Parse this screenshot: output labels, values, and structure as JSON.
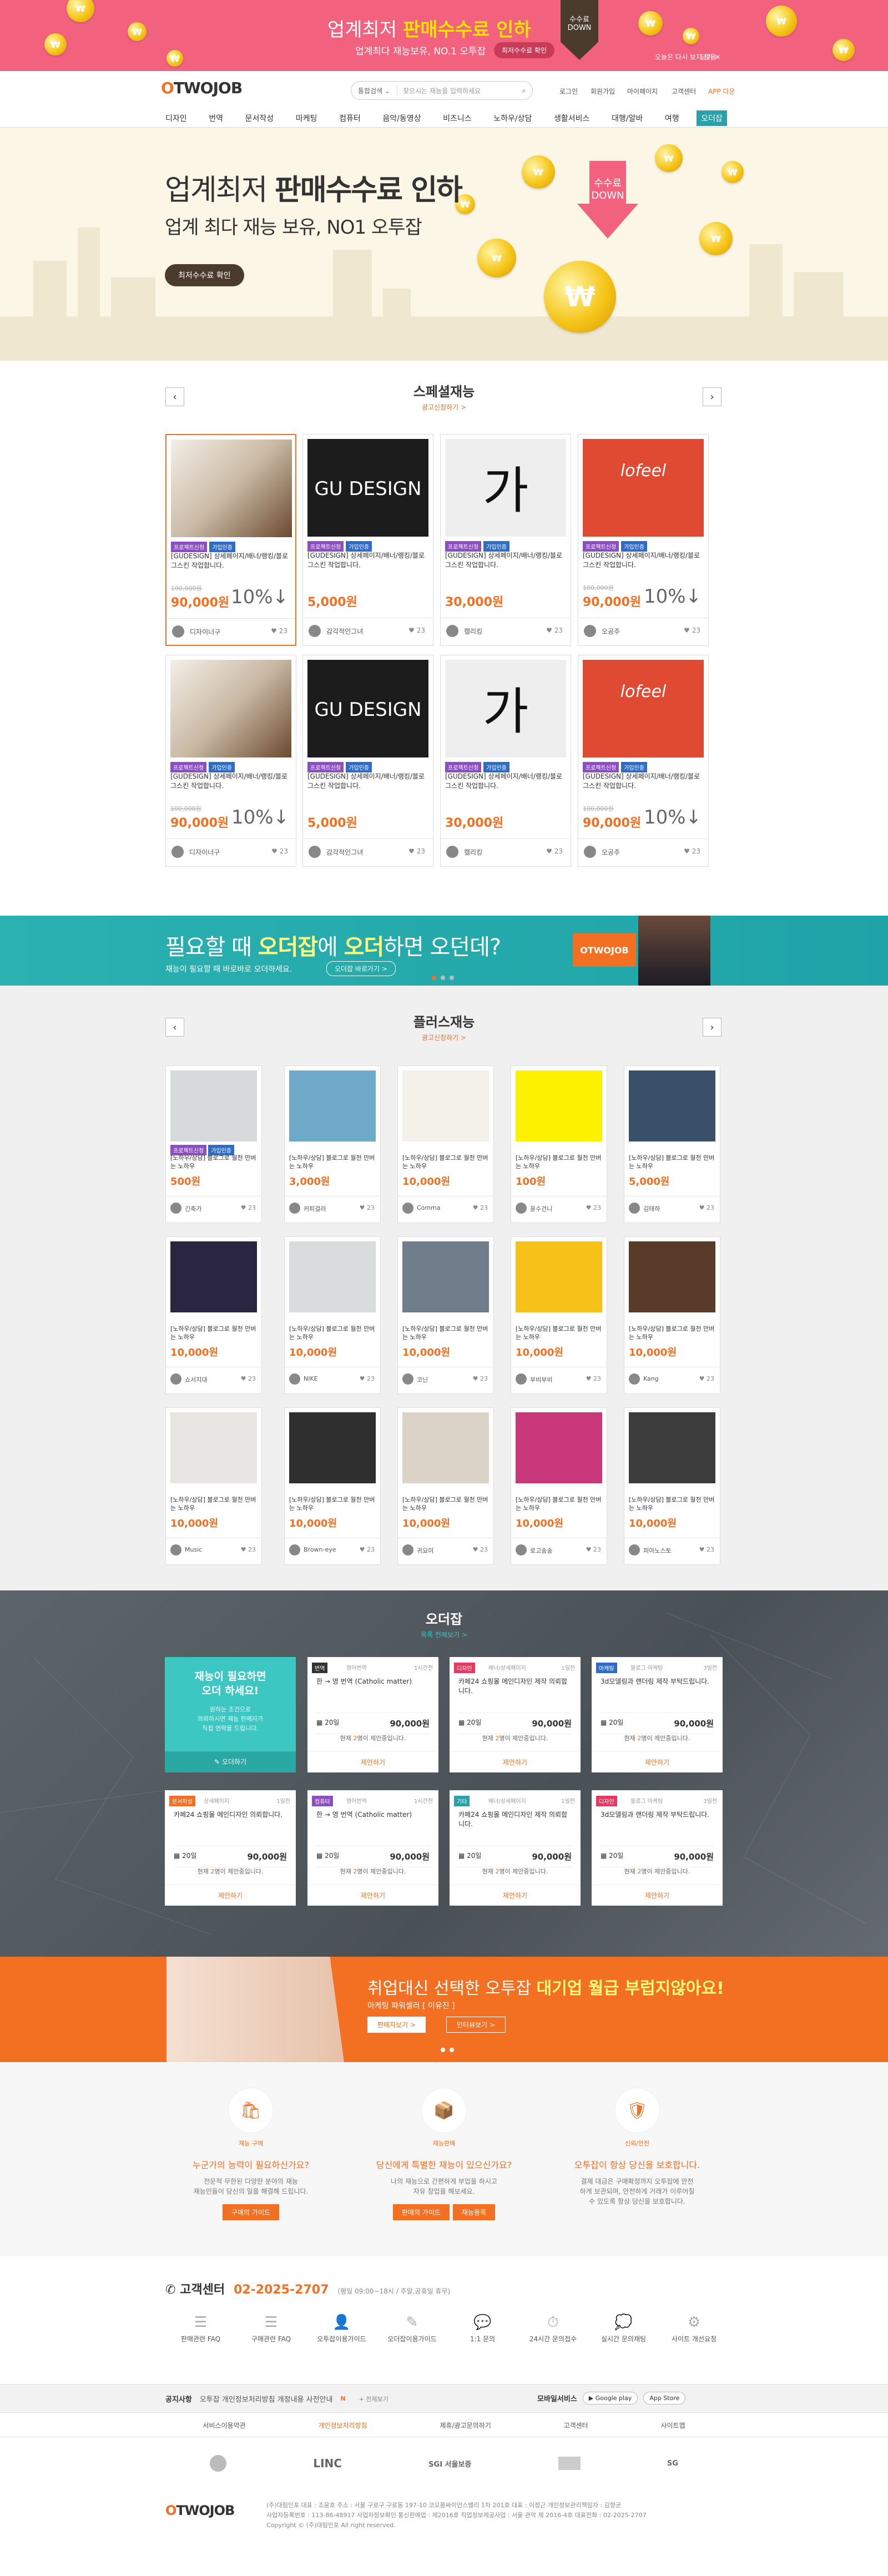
{
  "top_banner": {
    "title_pre": "업계최저 ",
    "title_bold": "판매수수료 인하",
    "subtitle": "업계최다 재능보유, NO.1 오투잡",
    "button": "최저수수료 확인",
    "arrow_line1": "수수료",
    "arrow_line2": "DOWN",
    "no_show": "오늘은 다시 보지 않음",
    "close": "닫기 ✕"
  },
  "header": {
    "logo_o": "O",
    "logo_rest": "TWOJOB",
    "search_select": "통합검색 ⌄",
    "search_placeholder": "찾으시는 재능을 입력하세요",
    "util": [
      "로그인",
      "회원가입",
      "마이페이지",
      "고객센터",
      "APP 다운"
    ],
    "nav": [
      "디자인",
      "번역",
      "문서작성",
      "마케팅",
      "컴퓨터",
      "음악/동영상",
      "비즈니스",
      "노하우/상담",
      "생활서비스",
      "대행/알바",
      "여행",
      "오더잡"
    ]
  },
  "hero": {
    "title_pre": "업계최저 ",
    "title_bold": "판매수수료 인하",
    "subtitle": "업계 최다 재능 보유, NO1 오투잡",
    "button": "최저수수료 확인",
    "down_line1": "수수료",
    "down_line2": "DOWN"
  },
  "special": {
    "title": "스페셜재능",
    "sub": "광고신청하기 >",
    "cards": [
      {
        "tags": [
          "프로젝트신청",
          "가입인증"
        ],
        "desc": "[GUDESIGN] 상세페이지/배너/랭킹/블로그스킨 작업합니다.",
        "old": "100,000원",
        "price": "90,000원",
        "badge": "10%↓",
        "seller": "디자이너구",
        "likes": "23",
        "img": "bottles"
      },
      {
        "tags": [
          "프로젝트신청",
          "가입인증"
        ],
        "desc": "[GUDESIGN] 상세페이지/배너/랭킹/블로그스킨 작업합니다.",
        "old": "",
        "price": "5,000원",
        "badge": "",
        "seller": "감각적인그녀",
        "likes": "23",
        "img": "gu"
      },
      {
        "tags": [
          "프로젝트신청",
          "가입인증"
        ],
        "desc": "[GUDESIGN] 상세페이지/배너/랭킹/블로그스킨 작업합니다.",
        "old": "",
        "price": "30,000원",
        "badge": "",
        "seller": "캘리킹",
        "likes": "23",
        "img": "calli"
      },
      {
        "tags": [
          "프로젝트신청",
          "가입인증"
        ],
        "desc": "[GUDESIGN] 상세페이지/배너/랭킹/블로그스킨 작업합니다.",
        "old": "100,000원",
        "price": "90,000원",
        "badge": "10%↓",
        "seller": "오공주",
        "likes": "23",
        "img": "lofeel"
      },
      {
        "tags": [
          "프로젝트신청",
          "가입인증"
        ],
        "desc": "[GUDESIGN] 상세페이지/배너/랭킹/블로그스킨 작업합니다.",
        "old": "100,000원",
        "price": "90,000원",
        "badge": "10%↓",
        "seller": "디자이너구",
        "likes": "23",
        "img": "bottles"
      },
      {
        "tags": [
          "프로젝트신청",
          "가입인증"
        ],
        "desc": "[GUDESIGN] 상세페이지/배너/랭킹/블로그스킨 작업합니다.",
        "old": "",
        "price": "5,000원",
        "badge": "",
        "seller": "감각적인그녀",
        "likes": "23",
        "img": "gu"
      },
      {
        "tags": [
          "프로젝트신청",
          "가입인증"
        ],
        "desc": "[GUDESIGN] 상세페이지/배너/랭킹/블로그스킨 작업합니다.",
        "old": "",
        "price": "30,000원",
        "badge": "",
        "seller": "캘리킹",
        "likes": "23",
        "img": "calli"
      },
      {
        "tags": [
          "프로젝트신청",
          "가입인증"
        ],
        "desc": "[GUDESIGN] 상세페이지/배너/랭킹/블로그스킨 작업합니다.",
        "old": "100,000원",
        "price": "90,000원",
        "badge": "10%↓",
        "seller": "오공주",
        "likes": "23",
        "img": "lofeel"
      }
    ]
  },
  "promo": {
    "t_pre": "필요할 때 ",
    "t_b1": "오더잡",
    "t_mid": "에 ",
    "t_b2": "오더",
    "t_post": "하면 오던데?",
    "sub": "재능이 필요할 때 바로바로 오더하세요.",
    "button": "오더잡 바로가기 >",
    "logo": "OTWOJOB"
  },
  "plus": {
    "title": "플러스재능",
    "sub": "광고신청하기 >",
    "desc": "[노하우/상담] 블로그로 월천 만버는 노하우",
    "cards": [
      {
        "price": "500원",
        "seller": "긴축가",
        "likes": "23",
        "color": "#d7dadb"
      },
      {
        "price": "3,000원",
        "seller": "커피걸러",
        "likes": "23",
        "color": "#6fa9c9"
      },
      {
        "price": "10,000원",
        "seller": "Comma",
        "likes": "23",
        "color": "#f4f1ea"
      },
      {
        "price": "100원",
        "seller": "윤수건니",
        "likes": "23",
        "color": "#fff200"
      },
      {
        "price": "5,000원",
        "seller": "김태하",
        "likes": "23",
        "color": "#3a4f6a"
      },
      {
        "price": "10,000원",
        "seller": "쇼서지대",
        "likes": "23",
        "color": "#2a2540"
      },
      {
        "price": "10,000원",
        "seller": "NIKE",
        "likes": "23",
        "color": "#d9dcdc"
      },
      {
        "price": "10,000원",
        "seller": "코닌",
        "likes": "23",
        "color": "#6f7d8a"
      },
      {
        "price": "10,000원",
        "seller": "부비부비",
        "likes": "23",
        "color": "#f6c21a"
      },
      {
        "price": "10,000원",
        "seller": "Kang",
        "likes": "23",
        "color": "#5a3b2a"
      },
      {
        "price": "10,000원",
        "seller": "Music",
        "likes": "23",
        "color": "#e8e6e2"
      },
      {
        "price": "10,000원",
        "seller": "Brown-eye",
        "likes": "23",
        "color": "#2f2f2f"
      },
      {
        "price": "10,000원",
        "seller": "귀요미",
        "likes": "23",
        "color": "#dcd3c8"
      },
      {
        "price": "10,000원",
        "seller": "로고송송",
        "likes": "23",
        "color": "#c8387a"
      },
      {
        "price": "10,000원",
        "seller": "피아노스토",
        "likes": "23",
        "color": "#3c3c3c"
      }
    ]
  },
  "order": {
    "title": "오더잡",
    "sub": "목록 전체보기 >",
    "first": {
      "t1": "재능이 필요하면",
      "t2": "오더 하세요!",
      "d1": "원하는 조건으로",
      "d2": "의뢰하시면 재능 판매자가",
      "d3": "직접 연락을 드립니다.",
      "btn": "오더하기"
    },
    "cards": [
      {
        "cat": "번역",
        "color": "#333333",
        "sub": "영어번역",
        "time": "1시간전",
        "title": "한 → 영 번역 (Catholic matter)",
        "days": "20일",
        "price": "90,000원",
        "cnt": "2"
      },
      {
        "cat": "디자인",
        "color": "#e8385e",
        "sub": "배너/상세페이지",
        "time": "1일전",
        "title": "카페24 쇼핑몰 메인디자인 제작 의뢰합니다.",
        "days": "20일",
        "price": "90,000원",
        "cnt": "2"
      },
      {
        "cat": "마케팅",
        "color": "#2f6cc6",
        "sub": "블로그 마케팅",
        "time": "3일전",
        "title": "3d모델링과 랜더링 제작 부탁드립니다.",
        "days": "20일",
        "price": "90,000원",
        "cnt": "2"
      },
      {
        "cat": "문서작성",
        "color": "#f36f21",
        "sub": "상세페이지",
        "time": "1일전",
        "title": "카페24 쇼핑몰 메인디자인 의뢰합니다.",
        "days": "20일",
        "price": "90,000원",
        "cnt": "2"
      },
      {
        "cat": "컴퓨터",
        "color": "#8b4fc2",
        "sub": "영어번역",
        "time": "1시간전",
        "title": "한 → 영 번역 (Catholic matter)",
        "days": "20일",
        "price": "90,000원",
        "cnt": "2"
      },
      {
        "cat": "기타",
        "color": "#2aa0a8",
        "sub": "배너/상세페이지",
        "time": "1일전",
        "title": "카페24 쇼핑몰 메인디자인 제작 의뢰합니다.",
        "days": "20일",
        "price": "90,000원",
        "cnt": "2"
      },
      {
        "cat": "디자인",
        "color": "#e8385e",
        "sub": "블로그 마케팅",
        "time": "3일전",
        "title": "3d모델링과 랜더링 제작 부탁드립니다.",
        "days": "20일",
        "price": "90,000원",
        "cnt": "2"
      }
    ],
    "cnt_pre": "현재 ",
    "cnt_post": "명이 제안중입니다.",
    "apply": "제안하기"
  },
  "career": {
    "t_pre": "취업대신 선택한 오투잡 ",
    "t_b": "대기업 월급 부럽지않아요!",
    "sub": "마케팅 파워셀러 [ 이유진 ]",
    "b1": "판매자보기 >",
    "b2": "인터뷰보기 >"
  },
  "features": [
    {
      "icon": "shopping-bag-icon",
      "glyph": "🛍",
      "lbl": "재능 구매",
      "h": "누군가의 능력이 필요하신가요?",
      "d1": "전문적 무한된 다양한 분야의 재능",
      "d2": "재능인들이 당신의 일을 해결해 드립니다.",
      "btns": [
        "구매의 가이드"
      ]
    },
    {
      "icon": "box-icon",
      "glyph": "📦",
      "lbl": "재능판매",
      "h": "당신에게 특별한 재능이 있으신가요?",
      "d1": "나의 재능으로 간편하게 부업을 하시고",
      "d2": "자유 창업을 해보세요.",
      "btns": [
        "판매의 가이드",
        "재능등록"
      ]
    },
    {
      "icon": "shield-icon",
      "glyph": "🛡",
      "lbl": "신뢰/안전",
      "h": "오투잡이 항상 당신을 보호합니다.",
      "d1": "결제 대금은 구매확정까지 오투잡에 안전",
      "d2": "하게 보관되며, 안전하게 거래가 이루어질",
      "d3": "수 있도록 항상 당신을 보호합니다.",
      "btns": []
    }
  ],
  "customer": {
    "title": "고객센터",
    "phone": "02-2025-2707",
    "hours": "(평일 09:00~18시 / 주말,공휴일 휴무)",
    "items": [
      {
        "label": "판매관련 FAQ",
        "glyph": "☰"
      },
      {
        "label": "구매관련 FAQ",
        "glyph": "☰"
      },
      {
        "label": "오투잡이용가이드",
        "glyph": "👤"
      },
      {
        "label": "오더잡이용가이드",
        "glyph": "✎"
      },
      {
        "label": "1:1 문의",
        "glyph": "💬"
      },
      {
        "label": "24시간 문의접수",
        "glyph": "⏱"
      },
      {
        "label": "실시간 문의채팅",
        "glyph": "💭"
      },
      {
        "label": "사이트 개선요청",
        "glyph": "⚙"
      }
    ]
  },
  "notice": {
    "label": "공지사항",
    "text": "오투잡 개인정보처리방침 개정내용 사전안내",
    "new": "N",
    "more": "+ 전체보기",
    "mobile": "모바일서비스",
    "gplay": "▶ Google play",
    "appstore": " App Store"
  },
  "footer_links": [
    "서비스이용약관",
    "개인정보처리방침",
    "제휴/광고문의하기",
    "고객센터",
    "사이트맵"
  ],
  "partners": [
    "LINC",
    "SGI 서울보증",
    "SG"
  ],
  "footer": {
    "line1": "(주)대림인포   대표 : 조윤호   주소 : 서울 구로구 구로동 197-10 코오롱싸이언스밸리 1차 201호   대표 : 이정근   개인정보관리책임자 : 김향균",
    "line2": "사업자등록번호 : 113-86-48917   사업자정보확인   통신판매업 : 제2016호   직업정보제공사업 : 서울 관악 제 2016-4호   대표전화 : 02-2025-2707",
    "copy": "Copyright © (주)대림인포 All right reserved."
  }
}
